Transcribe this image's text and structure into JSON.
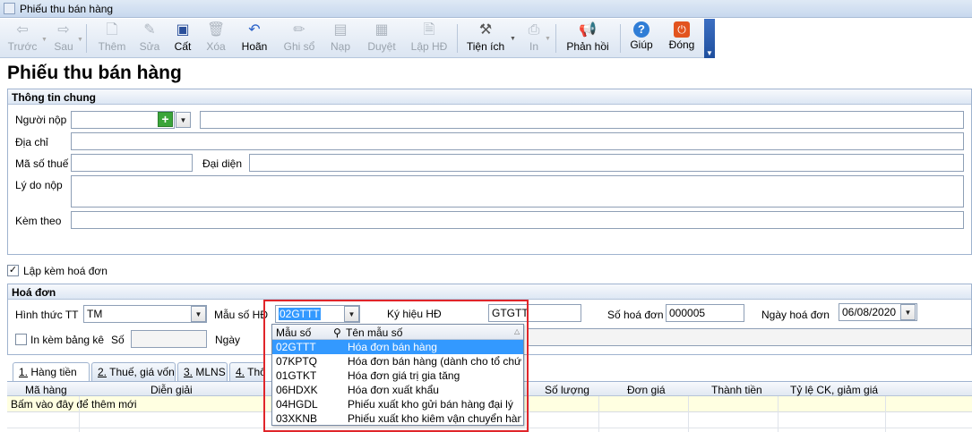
{
  "window": {
    "title": "Phiếu thu bán hàng"
  },
  "toolbar": {
    "prev": "Trước",
    "next": "Sau",
    "add": "Thêm",
    "edit": "Sửa",
    "save": "Cất",
    "delete": "Xóa",
    "undo": "Hoãn",
    "post": "Ghi sổ",
    "load": "Nạp",
    "approve": "Duyệt",
    "make_invoice": "Lập HĐ",
    "utilities": "Tiện ích",
    "print": "In",
    "feedback": "Phản hồi",
    "help": "Giúp",
    "close": "Đóng"
  },
  "page": {
    "title": "Phiếu thu bán hàng"
  },
  "general": {
    "header": "Thông tin chung",
    "payer_label": "Người nộp",
    "address_label": "Địa chỉ",
    "tax_code_label": "Mã số thuế",
    "representative_label": "Đại diện",
    "reason_label": "Lý do nộp",
    "attach_label": "Kèm theo"
  },
  "with_invoice": {
    "label": "Lập kèm hoá đơn",
    "checked": true
  },
  "invoice": {
    "header": "Hoá đơn",
    "payment_method_label": "Hình thức TT",
    "payment_method_value": "TM",
    "template_label": "Mẫu số HĐ",
    "template_value": "02GTTT",
    "symbol_label": "Ký hiệu HĐ",
    "symbol_value": "GTGTT",
    "number_label": "Số hoá đơn",
    "number_value": "000005",
    "date_label": "Ngày hoá đơn",
    "date_value": "06/08/2020",
    "print_list_label": "In kèm bảng kê",
    "so_label": "Số",
    "ngay_label": "Ngày"
  },
  "tabs": [
    {
      "num": "1.",
      "label": "Hàng tiền"
    },
    {
      "num": "2.",
      "label": "Thuế, giá vốn"
    },
    {
      "num": "3.",
      "label": "MLNS"
    },
    {
      "num": "4.",
      "label": "Thông"
    }
  ],
  "grid": {
    "columns": [
      "Mã hàng",
      "Diễn giải",
      "Số lượng",
      "Đơn giá",
      "Thành tiền",
      "Tỷ lệ CK, giảm giá"
    ],
    "new_row_hint": "Bấm vào đây để thêm mới"
  },
  "template_dropdown": {
    "col_code": "Mẫu số",
    "col_name": "Tên mẫu số",
    "rows": [
      {
        "code": "02GTTT",
        "name": "Hóa đơn bán hàng",
        "selected": true
      },
      {
        "code": "07KPTQ",
        "name": "Hóa đơn bán hàng (dành cho tổ chức...",
        "selected": false
      },
      {
        "code": "01GTKT",
        "name": "Hóa đơn giá trị gia tăng",
        "selected": false
      },
      {
        "code": "06HDXK",
        "name": "Hóa đơn xuất khẩu",
        "selected": false
      },
      {
        "code": "04HGDL",
        "name": "Phiếu xuất kho gửi bán hàng đại lý",
        "selected": false
      },
      {
        "code": "03XKNB",
        "name": "Phiếu xuất kho kiêm vận chuyển hàn...",
        "selected": false
      }
    ]
  },
  "colors": {
    "accent": "#3399ff",
    "highlight_border": "#e0252a",
    "add_icon": "#3aa53a"
  }
}
